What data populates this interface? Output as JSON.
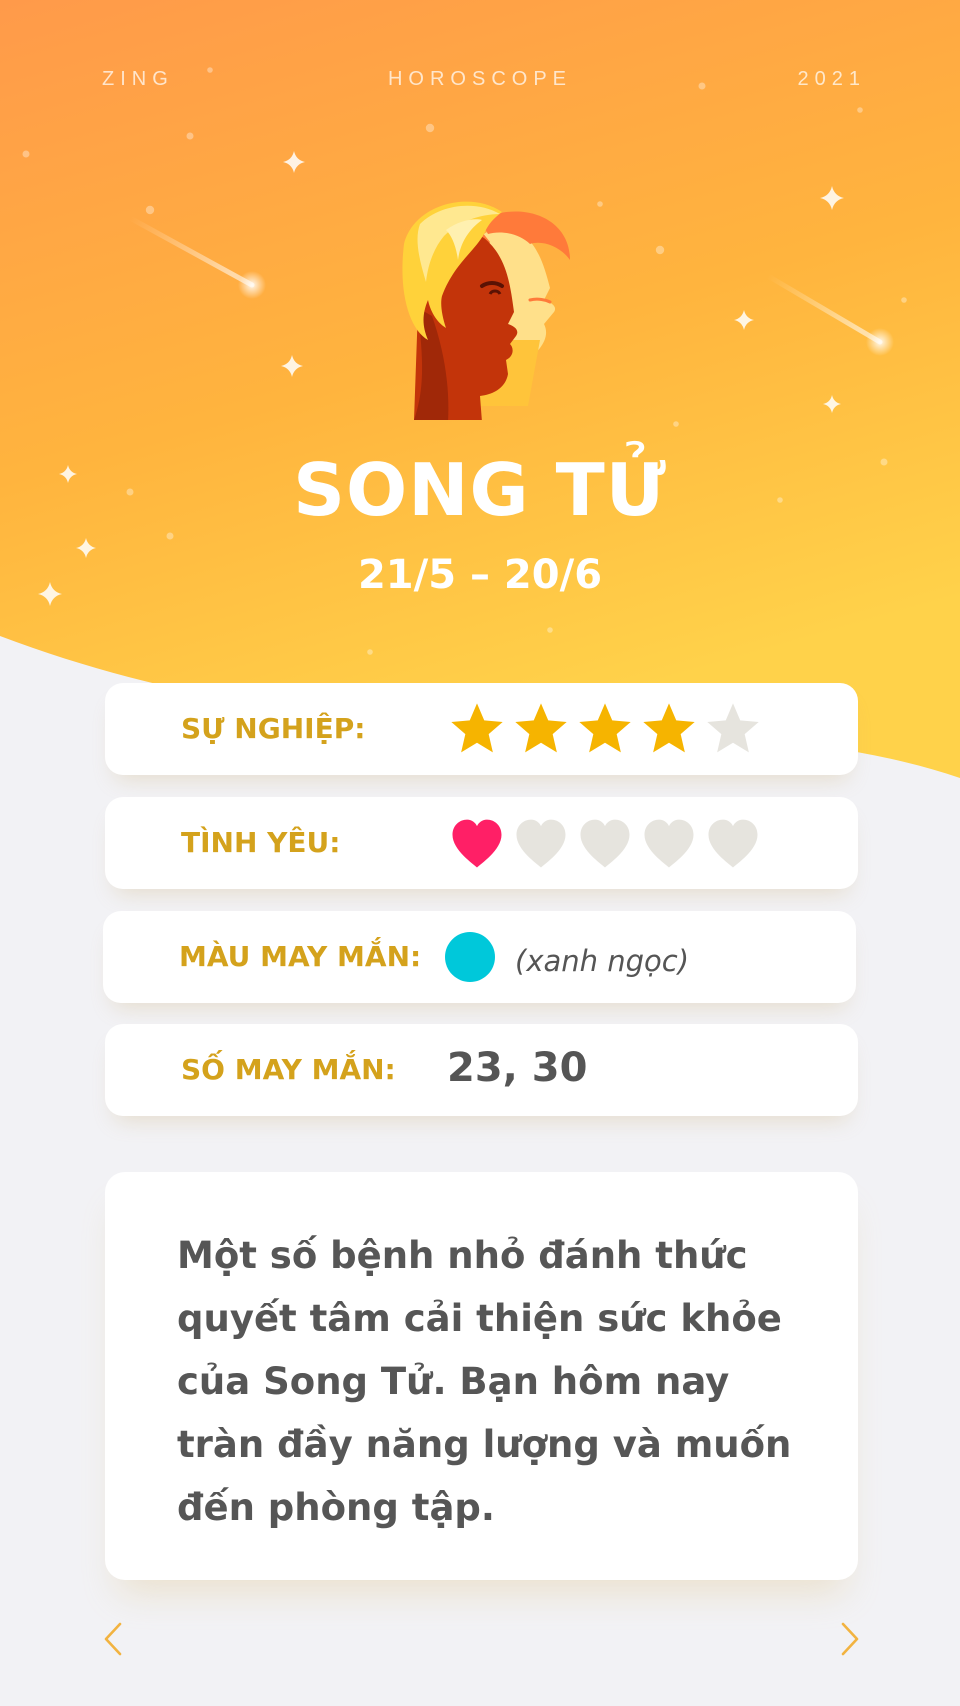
{
  "topbar": {
    "left": "ZING",
    "center": "HOROSCOPE",
    "right": "2021"
  },
  "sign": {
    "name": "SONG TỬ",
    "dates": "21/5 – 20/6",
    "icon": "gemini-twins-icon"
  },
  "ratings": [
    {
      "label": "SỰ NGHIỆP:",
      "icon": "star-icon",
      "value": 4,
      "max": 5,
      "active_color": "#f6b400",
      "inactive_color": "#e6e4de"
    },
    {
      "label": "TÌNH YÊU:",
      "icon": "heart-icon",
      "value": 1,
      "max": 5,
      "active_color": "#ff1f66",
      "inactive_color": "#e6e4de"
    }
  ],
  "lucky_color": {
    "label": "MÀU MAY MẮN:",
    "name": "(xanh ngọc)",
    "hex": "#00c8da"
  },
  "lucky_number": {
    "label": "SỐ MAY MẮN:",
    "value": "23, 30"
  },
  "description": "Một số bệnh nhỏ đánh thức quyết tâm cải thiện sức khỏe của Song Tử. Bạn hôm nay tràn đầy năng lượng và muốn đến phòng tập.",
  "nav": {
    "prev_icon": "chevron-left-icon",
    "next_icon": "chevron-right-icon"
  },
  "colors": {
    "bg_gradient_start": "#ff9a4a",
    "bg_gradient_end": "#ffd24a",
    "label": "#d4a21c",
    "text": "#565656",
    "page_bg": "#f2f2f5"
  }
}
